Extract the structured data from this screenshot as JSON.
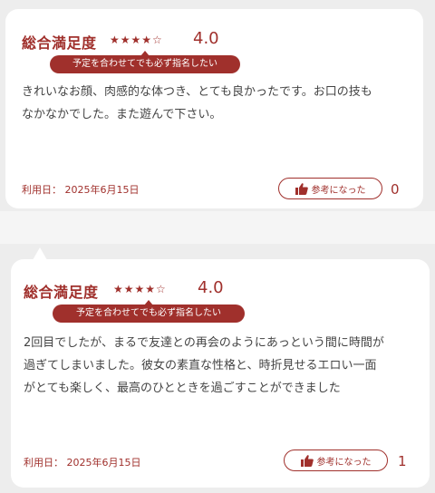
{
  "reviews": [
    {
      "satisfaction_label": "総合満足度",
      "stars": "★★★★☆",
      "score": "4.0",
      "tag": "予定を合わせてでも必ず指名したい",
      "text_lines": [
        "きれいなお顔、肉感的な体つき、とても良かったです。お口の技も",
        "なかなかでした。また遊んで下さい。"
      ],
      "date_text": "利用日： 2025年6月15日",
      "helpful_label": "参考になった",
      "helpful_count": "0"
    },
    {
      "satisfaction_label": "総合満足度",
      "stars": "★★★★☆",
      "score": "4.0",
      "tag": "予定を合わせてでも必ず指名したい",
      "text_lines": [
        "2回目でしたが、まるで友達との再会のようにあっという間に時間が",
        "過ぎてしまいました。彼女の素直な性格と、時折見せるエロい一面",
        "がとても楽しく、最高のひとときを過ごすことができました"
      ],
      "date_text": "利用日： 2025年6月15日",
      "helpful_label": "参考になった",
      "helpful_count": "1"
    }
  ],
  "colors": {
    "accent": "#a0302c",
    "background": "#ededed",
    "card": "#ffffff",
    "text": "#444444"
  },
  "icons": {
    "helpful": "thumbs-up-icon"
  }
}
